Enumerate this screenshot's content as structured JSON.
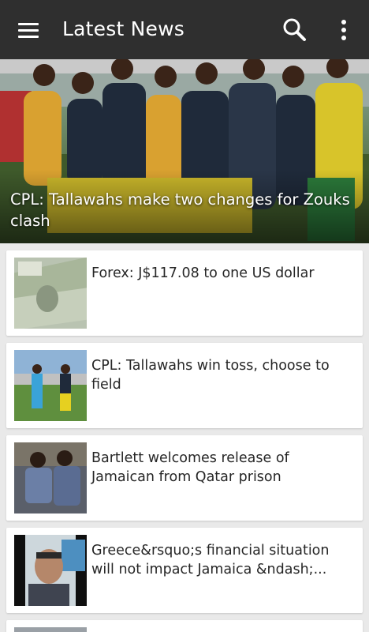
{
  "appbar": {
    "title": "Latest News",
    "menu_icon": "hamburger-menu-icon",
    "search_icon": "search-icon",
    "more_icon": "more-vert-icon",
    "background": "#2f2f2f"
  },
  "hero": {
    "title": "CPL: Tallawahs make two changes for Zouks clash"
  },
  "articles": [
    {
      "headline": "Forex: J$117.08 to one US dollar"
    },
    {
      "headline": "CPL: Tallawahs win toss, choose to field"
    },
    {
      "headline": "Bartlett welcomes release of Jamaican from Qatar prison"
    },
    {
      "headline": "Greece&rsquo;s financial situation will not impact Jamaica &ndash;..."
    }
  ]
}
